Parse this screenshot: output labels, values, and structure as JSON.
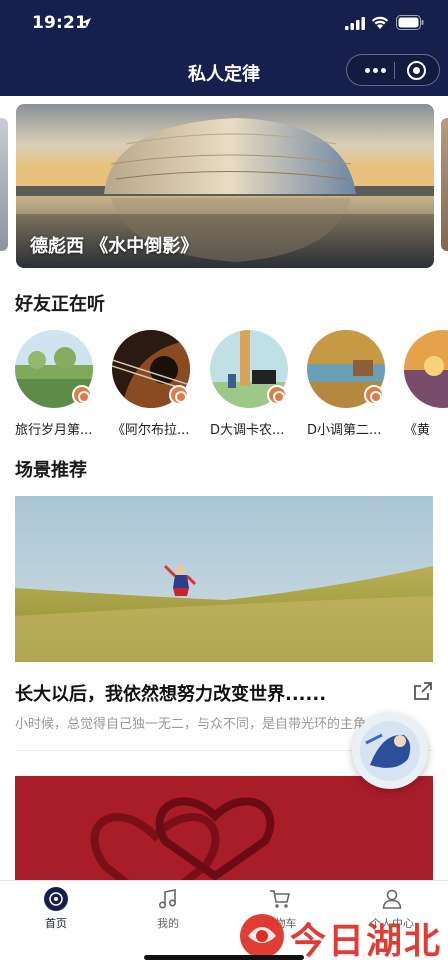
{
  "status_bar": {
    "time": "19:21"
  },
  "nav": {
    "title": "私人定律"
  },
  "banner": {
    "caption": "德彪西 《水中倒影》"
  },
  "friends_section": {
    "title": "好友正在听",
    "items": [
      {
        "label": "旅行岁月第..."
      },
      {
        "label": "《阿尔布拉..."
      },
      {
        "label": "D大调卡农..."
      },
      {
        "label": "D小调第二..."
      },
      {
        "label": "《黄"
      }
    ]
  },
  "scene_section": {
    "title": "场景推荐",
    "card": {
      "title": "长大以后，我依然想努力改变世界......",
      "desc": "小时候，总觉得自己独一无二，与众不同，是自带光环的主角"
    }
  },
  "tabbar": {
    "items": [
      {
        "label": "首页",
        "icon": "record-icon"
      },
      {
        "label": "我的",
        "icon": "music-note-icon"
      },
      {
        "label": "购物车",
        "icon": "cart-icon"
      },
      {
        "label": "个人中心",
        "icon": "user-icon"
      }
    ]
  },
  "watermark": {
    "text": "今日湖北"
  },
  "colors": {
    "nav_bg": "#17204d",
    "badge": "#e07c49",
    "active_tab": "#17204d"
  }
}
